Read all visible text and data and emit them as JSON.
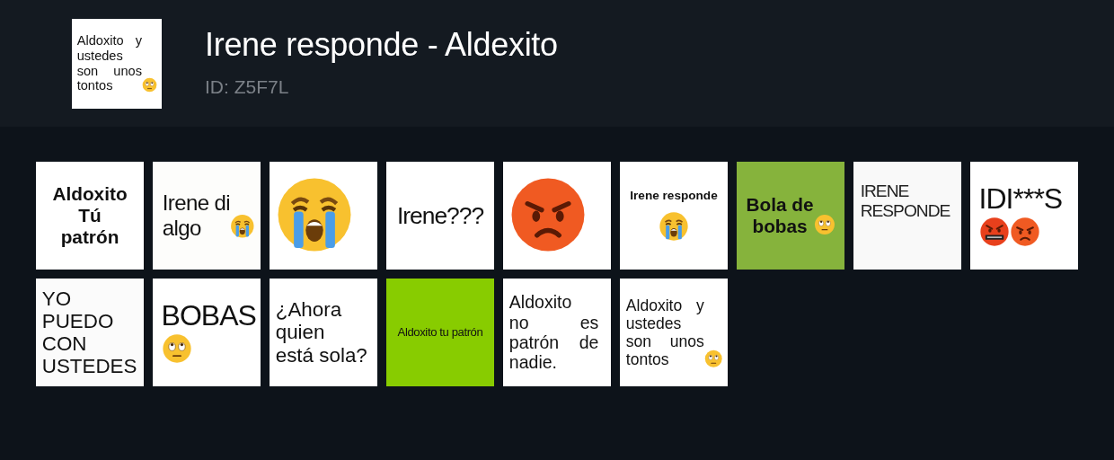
{
  "pack": {
    "title": "Irene responde - Aldexito",
    "id_label": "ID: Z5F7L",
    "thumbnail": {
      "text": "Aldoxito y\nustedes\nson unos\ntontos",
      "kind": "justify-m",
      "color": "#ffffff",
      "emojis": [
        {
          "kind": "eyeroll"
        }
      ]
    }
  },
  "stickers": [
    {
      "text": "Aldoxito\nTú\npatrón",
      "kind": "bold-l",
      "color": "#ffffff"
    },
    {
      "text": "Irene di\nalgo",
      "kind": "plain-l",
      "color": "#fdfdfb",
      "emojis": [
        {
          "kind": "crying"
        }
      ]
    },
    {
      "kind": "emoji",
      "color": "#ffffff",
      "emojis": [
        {
          "kind": "crying"
        }
      ]
    },
    {
      "text": "Irene???",
      "kind": "light-l",
      "color": "#ffffff"
    },
    {
      "kind": "emoji",
      "color": "#ffffff",
      "emojis": [
        {
          "kind": "angry"
        }
      ]
    },
    {
      "text": "Irene responde",
      "kind": "bold-s",
      "color": "#ffffff",
      "emojis": [
        {
          "kind": "crying"
        }
      ]
    },
    {
      "text": "Bola de\nbobas",
      "kind": "bold-l",
      "color": "#86b33c",
      "emojis": [
        {
          "kind": "eyeroll"
        }
      ]
    },
    {
      "text": "IRENE\nRESPONDE",
      "kind": "caps-m",
      "color": "#f9f9f9"
    },
    {
      "text": "IDI***S",
      "kind": "plain-xl",
      "color": "#ffffff",
      "emojis": [
        {
          "kind": "cursing"
        },
        {
          "kind": "angry"
        }
      ]
    },
    {
      "text": "YO\nPUEDO\nCON\nUSTEDES",
      "kind": "plain-m",
      "color": "#fbfbfb"
    },
    {
      "text": "BOBAS",
      "kind": "plain-xl",
      "color": "#ffffff",
      "emojis": [
        {
          "kind": "eyeroll"
        }
      ]
    },
    {
      "text": "¿Ahora\nquien\nestá sola?",
      "kind": "plain-m",
      "color": "#ffffff"
    },
    {
      "text": "Aldoxito tu patrón",
      "kind": "plain-s",
      "color": "#88cc00"
    },
    {
      "text": "Aldoxito\nno es\npatrón de\nnadie.",
      "kind": "justify-m",
      "color": "#ffffff"
    },
    {
      "text": "Aldoxito y\nustedes\nson unos\ntontos",
      "kind": "justify-m",
      "color": "#ffffff",
      "emojis": [
        {
          "kind": "eyeroll"
        }
      ]
    }
  ]
}
